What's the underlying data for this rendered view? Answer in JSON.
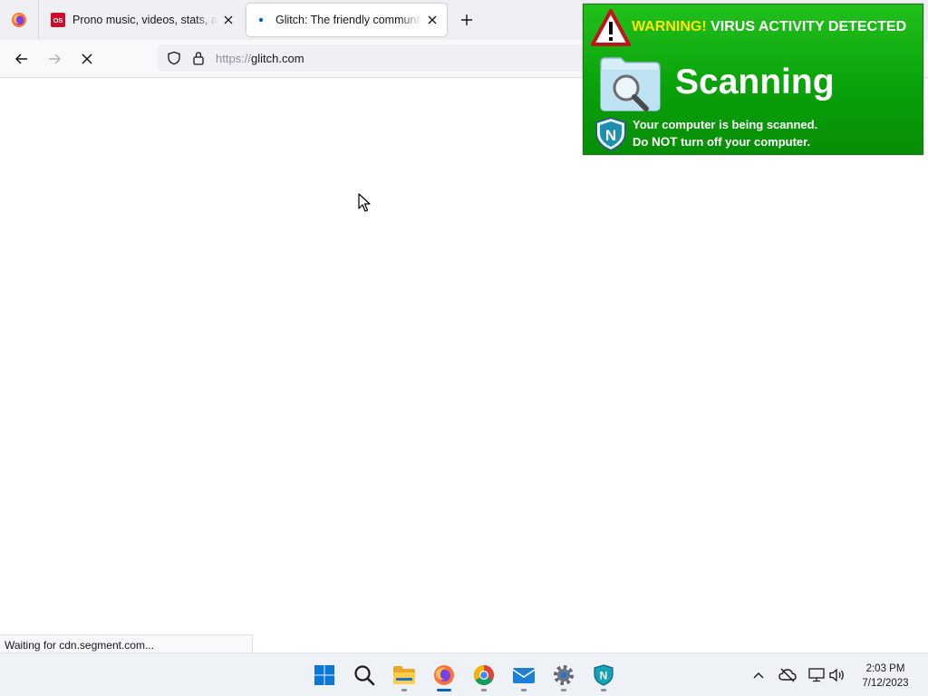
{
  "browser": {
    "tabs": [
      {
        "title": "Prono music, videos, stats, and photos",
        "favicon_text": "OS",
        "active": false
      },
      {
        "title": "Glitch: The friendly community where everyone builds the web",
        "active": true
      }
    ],
    "url": {
      "scheme": "https://",
      "host": "glitch.com"
    },
    "status_text": "Waiting for cdn.segment.com..."
  },
  "popup": {
    "warning_word": "WARNING!",
    "warning_rest": "VIRUS ACTIVITY DETECTED",
    "scan_title": "Scanning",
    "message_line1": "Your computer is being scanned.",
    "message_line2_pre": "Do",
    "message_line2_bold": "NOT",
    "message_line2_post": "turn off your computer.",
    "colors": {
      "background": "#14b014",
      "warning_word": "#ffe600"
    }
  },
  "taskbar": {
    "apps": [
      "start-icon",
      "search-icon",
      "file-explorer-icon",
      "firefox-icon",
      "chrome-icon",
      "mail-icon",
      "settings-icon",
      "antivirus-icon"
    ],
    "clock": {
      "time": "2:03 PM",
      "date": "7/12/2023"
    }
  }
}
